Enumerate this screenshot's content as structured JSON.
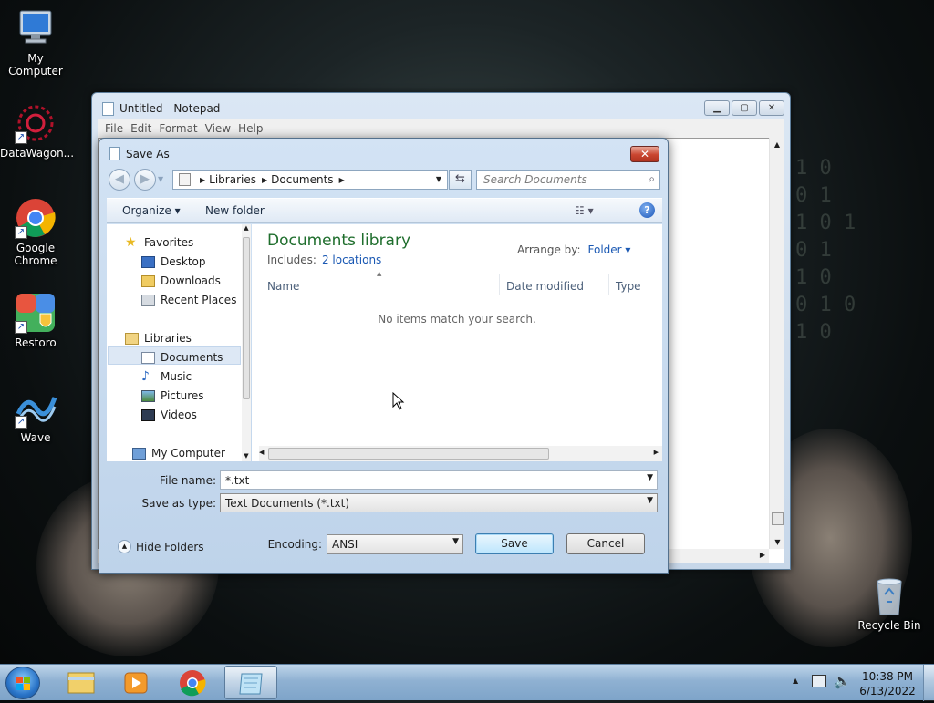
{
  "desktop": {
    "icons": [
      {
        "label": "My Computer"
      },
      {
        "label": "DataWagon..."
      },
      {
        "label": "Google Chrome"
      },
      {
        "label": "Restoro"
      },
      {
        "label": "Wave"
      },
      {
        "label": "Recycle Bin"
      }
    ]
  },
  "notepad": {
    "title": "Untitled - Notepad",
    "menu": [
      "File",
      "Edit",
      "Format",
      "View",
      "Help"
    ],
    "buttons": {
      "minimize": "▁",
      "maximize": "▢",
      "close": "✕"
    }
  },
  "dialog": {
    "title": "Save As",
    "close": "✕",
    "address": [
      "Libraries",
      "Documents"
    ],
    "search_placeholder": "Search Documents",
    "toolbar": {
      "organize": "Organize ▾",
      "new_folder": "New folder"
    },
    "nav": {
      "favorites": "Favorites",
      "desktop": "Desktop",
      "downloads": "Downloads",
      "recent": "Recent Places",
      "libraries": "Libraries",
      "documents": "Documents",
      "music": "Music",
      "pictures": "Pictures",
      "videos": "Videos",
      "computer": "My Computer"
    },
    "library_title": "Documents library",
    "includes_label": "Includes:",
    "includes_link": "2 locations",
    "arrange_label": "Arrange by:",
    "arrange_value": "Folder ▾",
    "columns": [
      "Name",
      "Date modified",
      "Type"
    ],
    "empty_message": "No items match your search.",
    "file_name_label": "File name:",
    "file_name_value": "*.txt",
    "save_type_label": "Save as type:",
    "save_type_value": "Text Documents (*.txt)",
    "hide_folders": "Hide Folders",
    "encoding_label": "Encoding:",
    "encoding_value": "ANSI",
    "save": "Save",
    "cancel": "Cancel"
  },
  "taskbar": {
    "time": "10:38 PM",
    "date": "6/13/2022"
  },
  "colors": {
    "library_title": "#1f6e2d",
    "link": "#1a58b3",
    "close_red": "#c9452f"
  }
}
